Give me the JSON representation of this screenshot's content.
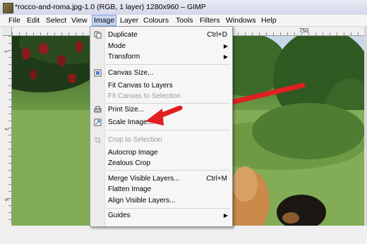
{
  "window": {
    "title": "*rocco-and-roma.jpg-1.0 (RGB, 1 layer) 1280x960 – GIMP"
  },
  "menubar": {
    "items": [
      "File",
      "Edit",
      "Select",
      "View",
      "Image",
      "Layer",
      "Colours",
      "Tools",
      "Filters",
      "Windows",
      "Help"
    ],
    "active": "Image"
  },
  "ruler": {
    "top_label": "750",
    "left_labels": [
      "1",
      "2",
      "5"
    ]
  },
  "image_menu": {
    "items": [
      {
        "label": "Duplicate",
        "shortcut": "Ctrl+D",
        "enabled": true,
        "icon": "duplicate-icon"
      },
      {
        "label": "Mode",
        "submenu": true,
        "enabled": true
      },
      {
        "label": "Transform",
        "submenu": true,
        "enabled": true
      },
      {
        "label": "Canvas Size...",
        "enabled": true,
        "icon": "canvas-size-icon"
      },
      {
        "label": "Fit Canvas to Layers",
        "enabled": true
      },
      {
        "label": "Fit Canvas to Selection",
        "enabled": false
      },
      {
        "label": "Print Size...",
        "enabled": true,
        "icon": "print-size-icon"
      },
      {
        "label": "Scale Image...",
        "enabled": true,
        "icon": "scale-image-icon"
      },
      {
        "label": "Crop to Selection",
        "enabled": false,
        "icon": "crop-icon"
      },
      {
        "label": "Autocrop Image",
        "enabled": true
      },
      {
        "label": "Zealous Crop",
        "enabled": true
      },
      {
        "label": "Merge Visible Layers...",
        "shortcut": "Ctrl+M",
        "enabled": true
      },
      {
        "label": "Flatten Image",
        "enabled": true
      },
      {
        "label": "Align Visible Layers...",
        "enabled": true
      },
      {
        "label": "Guides",
        "submenu": true,
        "enabled": true
      }
    ]
  },
  "colors": {
    "annotation_arrow": "#e02020",
    "menu_highlight": "#c6d6ef"
  }
}
